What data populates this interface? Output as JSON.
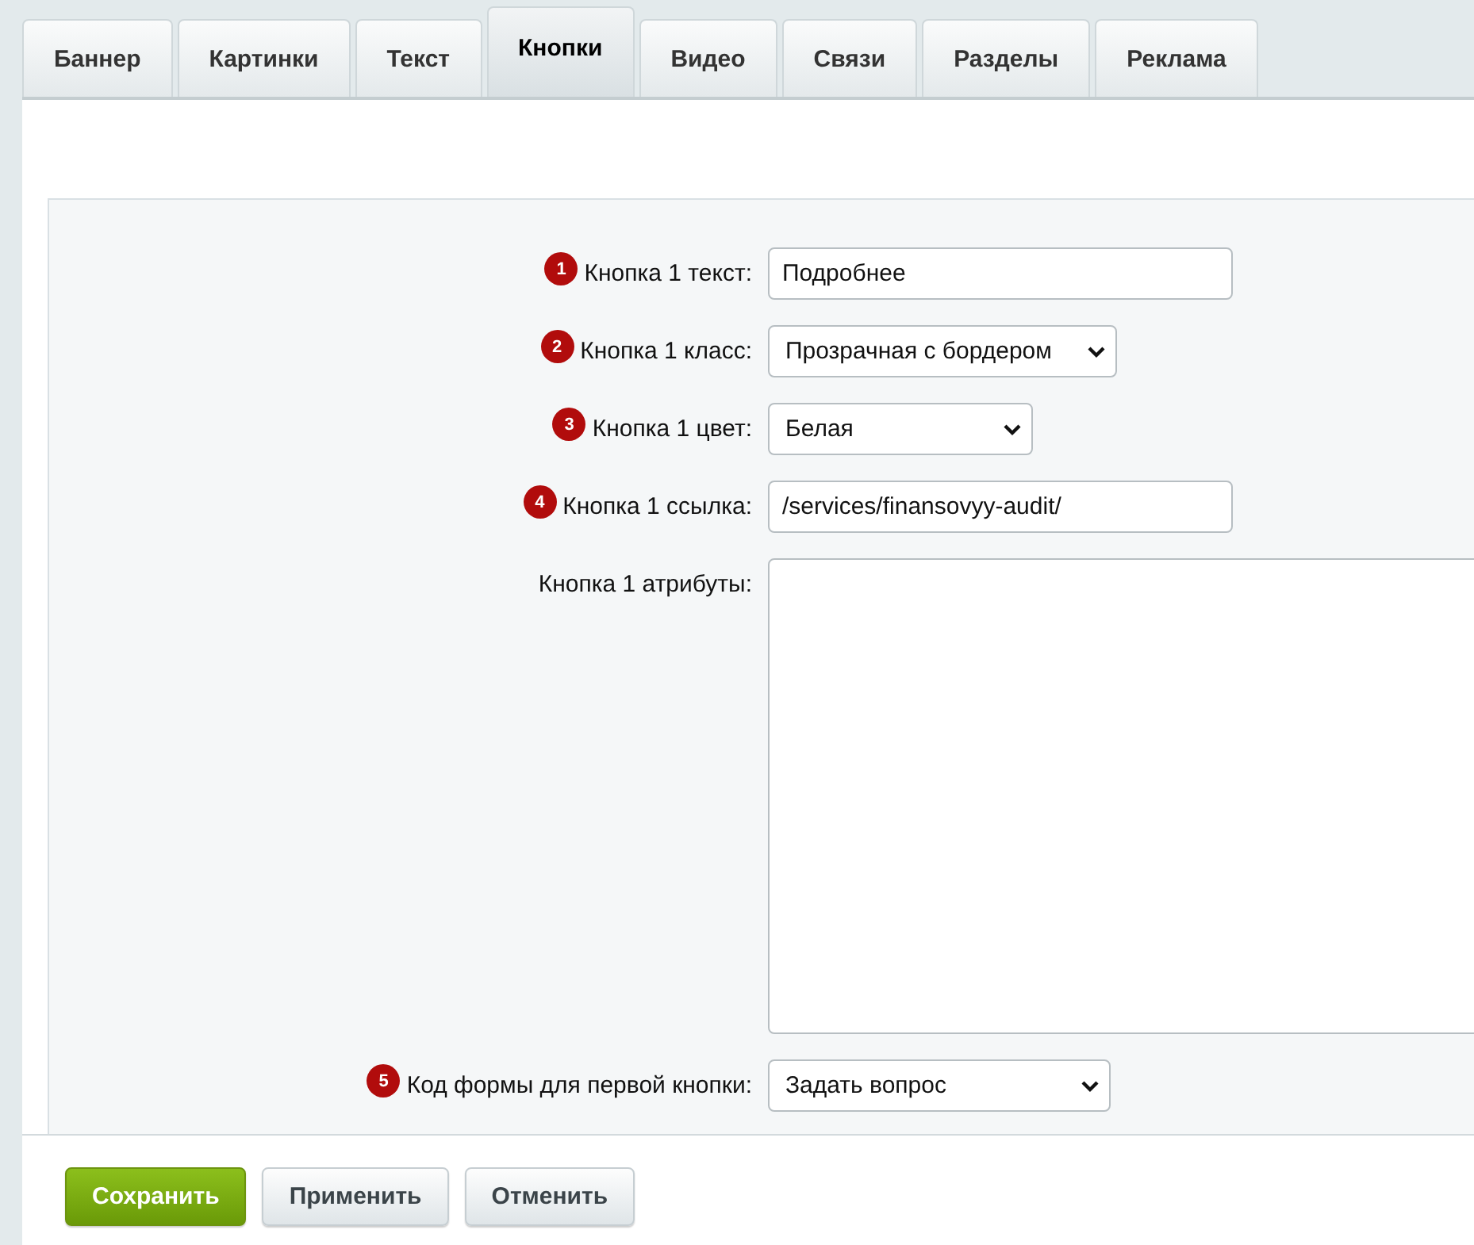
{
  "tabs": [
    {
      "label": "Баннер",
      "selected": false
    },
    {
      "label": "Картинки",
      "selected": false
    },
    {
      "label": "Текст",
      "selected": false
    },
    {
      "label": "Кнопки",
      "selected": true
    },
    {
      "label": "Видео",
      "selected": false
    },
    {
      "label": "Связи",
      "selected": false
    },
    {
      "label": "Разделы",
      "selected": false
    },
    {
      "label": "Реклама",
      "selected": false
    }
  ],
  "fields": [
    {
      "kind": "text",
      "badge": "1",
      "label": "Кнопка 1 текст:",
      "value": "Подробнее"
    },
    {
      "kind": "select",
      "badge": "2",
      "label": "Кнопка 1 класс:",
      "value": "Прозрачная с бордером"
    },
    {
      "kind": "select",
      "badge": "3",
      "label": "Кнопка 1 цвет:",
      "value": "Белая"
    },
    {
      "kind": "text",
      "badge": "4",
      "label": "Кнопка 1 ссылка:",
      "value": "/services/finansovyy-audit/"
    },
    {
      "kind": "textarea",
      "label": "Кнопка 1 атрибуты:"
    },
    {
      "kind": "select",
      "badge": "5",
      "label": "Код формы для первой кнопки:",
      "value": "Задать вопрос"
    }
  ],
  "buttons": [
    {
      "label": "Сохранить",
      "kind": "primary"
    },
    {
      "label": "Применить",
      "kind": "default"
    },
    {
      "label": "Отменить",
      "kind": "default"
    }
  ]
}
